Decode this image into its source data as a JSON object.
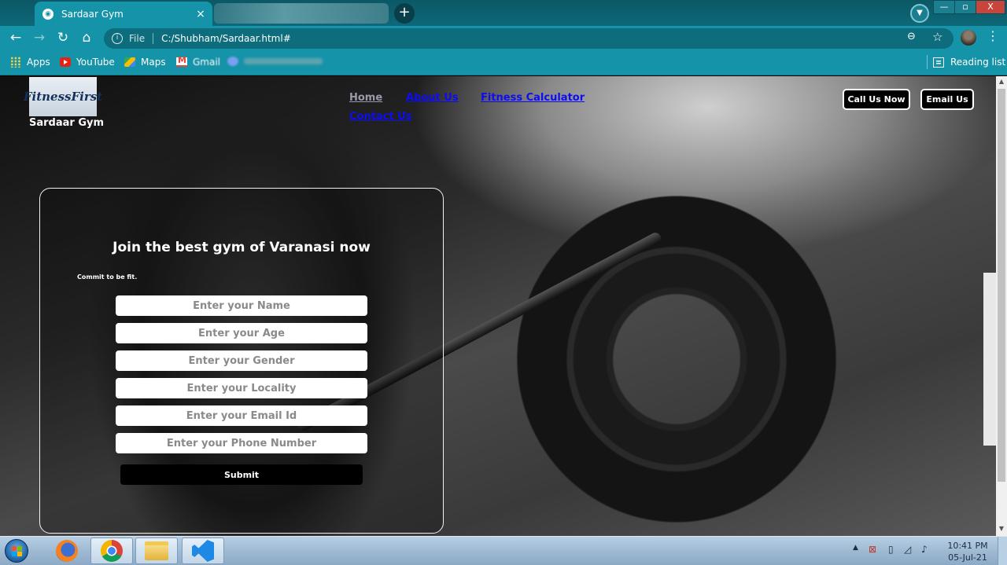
{
  "browser": {
    "tab_title": "Sardaar Gym",
    "tab_close": "×",
    "new_tab": "+",
    "url_prefix": "File",
    "url": "C:/Shubham/Sardaar.html#",
    "minimize": "—",
    "maximize": "▫",
    "close": "X"
  },
  "bookmarks": {
    "apps": "Apps",
    "youtube": "YouTube",
    "maps": "Maps",
    "gmail": "Gmail",
    "reading_list": "Reading list"
  },
  "site": {
    "logo_text": "FitnessFirst",
    "name": "Sardaar Gym",
    "nav": {
      "home": "Home",
      "about": "About Us",
      "calculator": "Fitness Calculator",
      "contact": "Contact Us"
    },
    "call_button": "Call Us Now",
    "email_button": "Email Us"
  },
  "form": {
    "title": "Join the best gym of Varanasi now",
    "subtitle": "Commit to be fit.",
    "fields": {
      "name": "Enter your Name",
      "age": "Enter your Age",
      "gender": "Enter your Gender",
      "locality": "Enter your Locality",
      "email": "Enter your Email Id",
      "phone": "Enter your Phone Number"
    },
    "submit": "Submit"
  },
  "taskbar": {
    "time": "10:41 PM",
    "date": "05-Jul-21"
  }
}
